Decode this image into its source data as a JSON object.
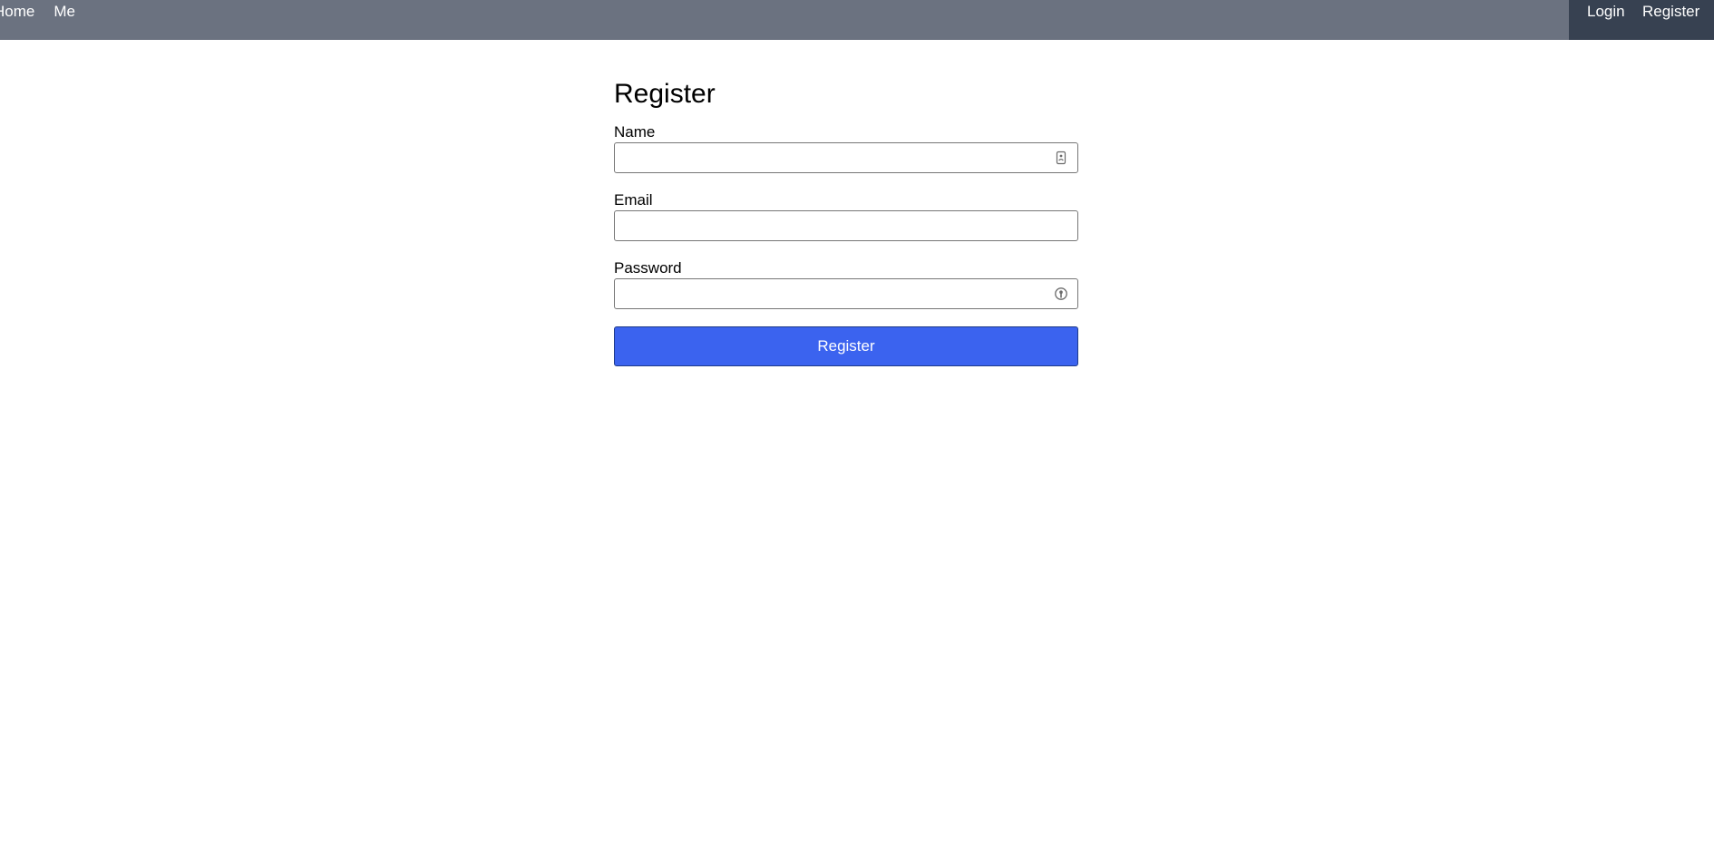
{
  "nav": {
    "left_links": [
      "Home",
      "Me"
    ],
    "login_label": "Login",
    "register_label": "Register"
  },
  "form": {
    "title": "Register",
    "name_label": "Name",
    "name_value": "",
    "name_icon": "contact-card-icon",
    "email_label": "Email",
    "email_value": "",
    "password_label": "Password",
    "password_value": "",
    "password_icon": "password-key-icon",
    "submit_label": "Register"
  },
  "colors": {
    "topbar": "#6b7280",
    "topbar_right": "#374151",
    "primary_button": "#3b63ef"
  }
}
